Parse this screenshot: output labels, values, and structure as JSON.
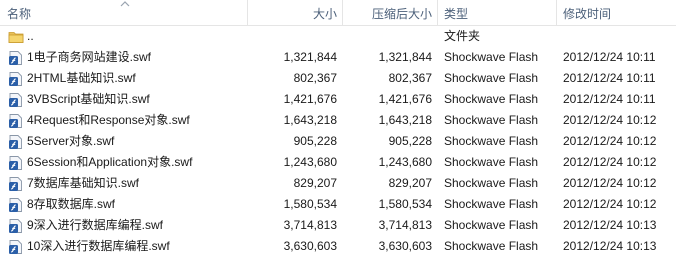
{
  "columns": {
    "name": "名称",
    "size": "大小",
    "compressed": "压缩后大小",
    "type": "类型",
    "modified": "修改时间"
  },
  "parent_row": {
    "name": "..",
    "type": "文件夹"
  },
  "files": [
    {
      "name": "1电子商务网站建设.swf",
      "size": "1,321,844",
      "compressed": "1,321,844",
      "type": "Shockwave Flash",
      "modified": "2012/12/24 10:11",
      "icon": "flash-file-icon"
    },
    {
      "name": "2HTML基础知识.swf",
      "size": "802,367",
      "compressed": "802,367",
      "type": "Shockwave Flash",
      "modified": "2012/12/24 10:11",
      "icon": "flash-file-icon"
    },
    {
      "name": "3VBScript基础知识.swf",
      "size": "1,421,676",
      "compressed": "1,421,676",
      "type": "Shockwave Flash",
      "modified": "2012/12/24 10:11",
      "icon": "flash-file-icon"
    },
    {
      "name": "4Request和Response对象.swf",
      "size": "1,643,218",
      "compressed": "1,643,218",
      "type": "Shockwave Flash",
      "modified": "2012/12/24 10:12",
      "icon": "flash-file-icon"
    },
    {
      "name": "5Server对象.swf",
      "size": "905,228",
      "compressed": "905,228",
      "type": "Shockwave Flash",
      "modified": "2012/12/24 10:12",
      "icon": "flash-file-icon"
    },
    {
      "name": "6Session和Application对象.swf",
      "size": "1,243,680",
      "compressed": "1,243,680",
      "type": "Shockwave Flash",
      "modified": "2012/12/24 10:12",
      "icon": "flash-file-icon"
    },
    {
      "name": "7数据库基础知识.swf",
      "size": "829,207",
      "compressed": "829,207",
      "type": "Shockwave Flash",
      "modified": "2012/12/24 10:12",
      "icon": "flash-file-icon"
    },
    {
      "name": "8存取数据库.swf",
      "size": "1,580,534",
      "compressed": "1,580,534",
      "type": "Shockwave Flash",
      "modified": "2012/12/24 10:12",
      "icon": "flash-file-icon"
    },
    {
      "name": "9深入进行数据库编程.swf",
      "size": "3,714,813",
      "compressed": "3,714,813",
      "type": "Shockwave Flash",
      "modified": "2012/12/24 10:13",
      "icon": "flash-file-icon"
    },
    {
      "name": "10深入进行数据库编程.swf",
      "size": "3,630,603",
      "compressed": "3,630,603",
      "type": "Shockwave Flash",
      "modified": "2012/12/24 10:13",
      "icon": "flash-file-icon"
    }
  ],
  "colors": {
    "header_text": "#4c607a",
    "folder": "#e8c15a",
    "flash_icon": "#2b5fa8"
  }
}
